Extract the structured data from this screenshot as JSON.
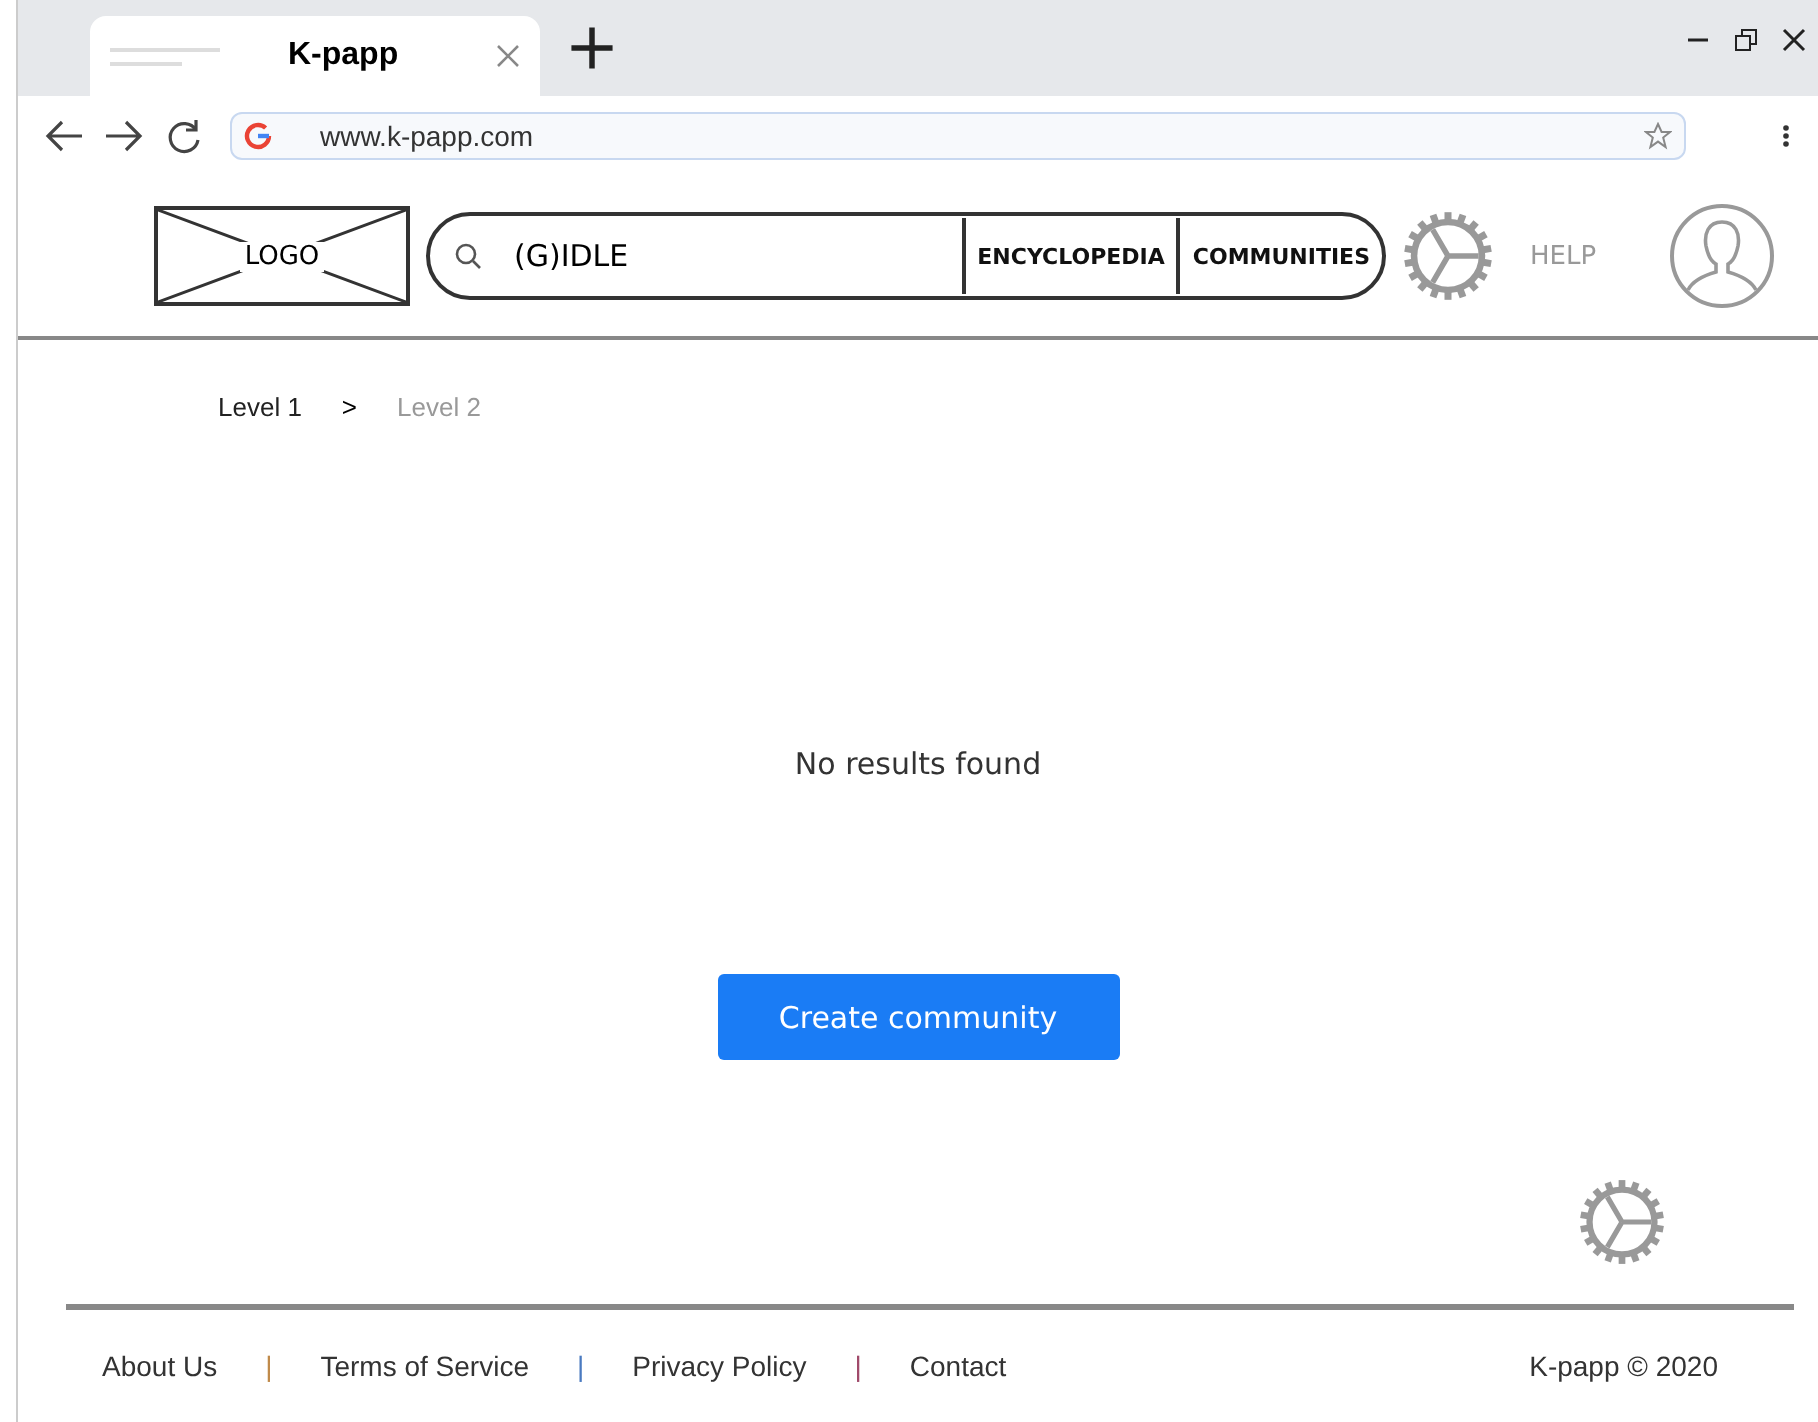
{
  "browser": {
    "tab_title": "K-papp",
    "url": "www.k-papp.com"
  },
  "header": {
    "logo": "LOGO",
    "search": {
      "value": "(G)IDLE"
    },
    "nav": [
      "ENCYCLOPEDIA",
      "COMMUNITIES"
    ],
    "help": "HELP"
  },
  "breadcrumb": [
    {
      "label": "Level 1",
      "selected": false
    },
    {
      "label": "Level 2",
      "selected": true
    }
  ],
  "breadcrumb_separator": ">",
  "message": "No results found",
  "create_button": "Create community",
  "footer": {
    "links": [
      {
        "label": "About Us"
      },
      {
        "label": "Terms of Service"
      },
      {
        "label": "Privacy Policy"
      },
      {
        "label": "Contact"
      }
    ],
    "separators": [
      {
        "text": "|",
        "color": "#c08a4a"
      },
      {
        "text": "|",
        "color": "#4a7ac0"
      },
      {
        "text": "|",
        "color": "#a04a6a"
      }
    ],
    "copyright": "K-papp © 2020"
  }
}
